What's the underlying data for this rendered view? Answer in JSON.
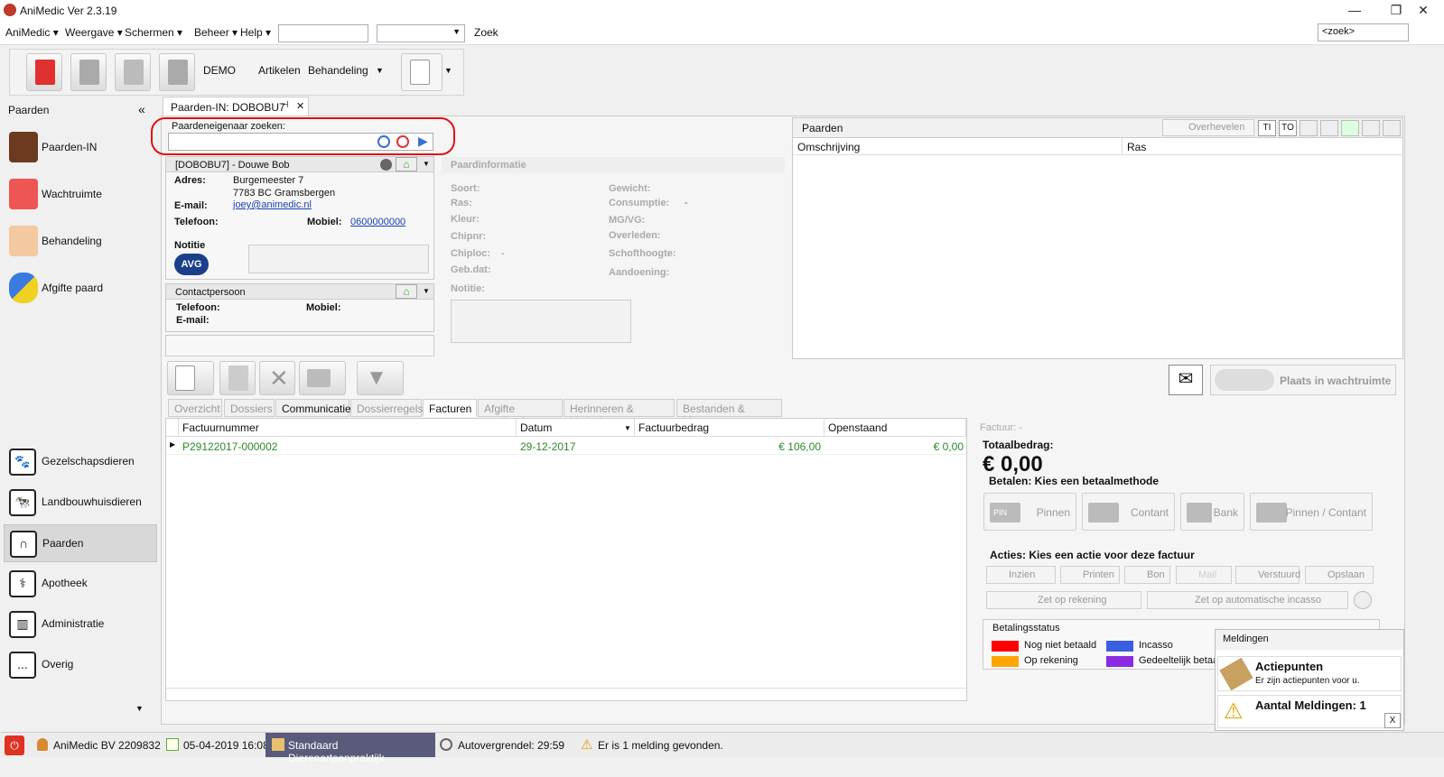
{
  "window": {
    "title": "AniMedic Ver 2.3.19"
  },
  "menu": {
    "items": [
      "AniMedic ▾",
      "Weergave ▾",
      "Schermen ▾",
      "Beheer ▾",
      "Help ▾"
    ],
    "zoek_label": "Zoek",
    "search_placeholder": "<zoek>"
  },
  "toolbar": {
    "demo": "DEMO",
    "artikelen": "Artikelen",
    "behandeling": "Behandeling"
  },
  "sidebar": {
    "header": "Paarden",
    "collapse": "«",
    "items": [
      "Paarden-IN",
      "Wachtruimte",
      "Behandeling",
      "Afgifte paard"
    ],
    "bottom": [
      "Gezelschapsdieren",
      "Landbouwhuisdieren",
      "Paarden",
      "Apotheek",
      "Administratie",
      "Overig"
    ],
    "overig_glyph": "..."
  },
  "doc_tab": {
    "label": "Paarden-IN: DOBOBU7",
    "pin": "⊣",
    "close": "✕"
  },
  "owner_search": {
    "label": "Paardeneigenaar zoeken:",
    "value": ""
  },
  "owner": {
    "header": "[DOBOBU7] - Douwe Bob",
    "adres_label": "Adres:",
    "adres_line1": "Burgemeester 7",
    "adres_line2": "7783 BC Gramsbergen",
    "email_label": "E-mail:",
    "email": "joey@animedic.nl",
    "telefoon_label": "Telefoon:",
    "mobiel_label": "Mobiel:",
    "mobiel": "0600000000",
    "notitie_label": "Notitie",
    "avg": "AVG"
  },
  "contact": {
    "header": "Contactpersoon",
    "telefoon_label": "Telefoon:",
    "mobiel_label": "Mobiel:",
    "email_label": "E-mail:"
  },
  "horse_info": {
    "header": "Paardinformatie",
    "left": [
      "Soort:",
      "Ras:",
      "Kleur:",
      "Chipnr:",
      "Chiploc:",
      "Geb.dat:",
      "Notitie:"
    ],
    "chiploc_val": "-",
    "right": [
      "Gewicht:",
      "Consumptie:",
      "MG/VG:",
      "Overleden:",
      "Schofthoogte:",
      "Aandoening:"
    ],
    "consumptie_val": "-"
  },
  "horses_panel": {
    "title": "Paarden",
    "overhevelen": "Overhevelen",
    "ti": "TI",
    "to": "TO",
    "col_omschrijving": "Omschrijving",
    "col_ras": "Ras"
  },
  "wachtruimte_button": "Plaats in wachtruimte",
  "tabs": [
    "Overzicht",
    "Dossiers",
    "Communicatie",
    "Dossierregels",
    "Facturen",
    "Afgifte medicatie",
    "Herinneren & Herhalen",
    "Bestanden & Mappen"
  ],
  "invoice_table": {
    "columns": [
      "Factuurnummer",
      "Datum",
      "Factuurbedrag",
      "Openstaand"
    ],
    "rows": [
      {
        "nummer": "P29122017-000002",
        "datum": "29-12-2017",
        "bedrag": "€ 106,00",
        "open": "€ 0,00"
      }
    ]
  },
  "invoice_detail": {
    "factuur": "Factuur: -",
    "totaal_label": "Totaalbedrag:",
    "totaal": "€ 0,00",
    "betalen": "Betalen: Kies een betaalmethode",
    "pay_buttons": [
      "Pinnen",
      "Contant",
      "Bank",
      "Pinnen / Contant"
    ],
    "pin_text": "PIN",
    "acties": "Acties: Kies een actie voor deze factuur",
    "actions": [
      "Inzien",
      "Printen",
      "Bon",
      "Mail",
      "Verstuurd",
      "Opslaan"
    ],
    "zet_rekening": "Zet op rekening",
    "zet_incasso": "Zet op automatische incasso",
    "betalingsstatus": "Betalingsstatus",
    "legend": [
      {
        "label": "Nog niet betaald",
        "color": "#ff0000"
      },
      {
        "label": "Incasso",
        "color": "#3a5fe0"
      },
      {
        "label": "Op rekening",
        "color": "#ffa500"
      },
      {
        "label": "Gedeeltelijk betaa",
        "color": "#8a2be2"
      }
    ]
  },
  "notifications": {
    "header": "Meldingen",
    "actie_title": "Actiepunten",
    "actie_sub": "Er zijn actiepunten voor u.",
    "aantal": "Aantal Meldingen:  1",
    "close": "X"
  },
  "statusbar": {
    "company": "AniMedic  BV 2209832",
    "datetime": "05-04-2019 16:08",
    "practice": "Standaard Dierenartsenpraktijk",
    "autolock": "Autovergrendel:  29:59",
    "melding": "Er is 1 melding gevonden."
  }
}
